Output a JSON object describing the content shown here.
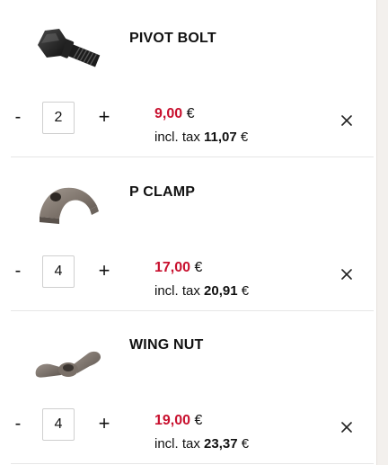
{
  "cart": {
    "items": [
      {
        "name": "PIVOT BOLT",
        "quantity": "2",
        "price": "9,00",
        "currency": "€",
        "tax_label": "incl. tax",
        "price_incl_tax": "11,07",
        "image": "pivot-bolt-image"
      },
      {
        "name": "P CLAMP",
        "quantity": "4",
        "price": "17,00",
        "currency": "€",
        "tax_label": "incl. tax",
        "price_incl_tax": "20,91",
        "image": "p-clamp-image"
      },
      {
        "name": "WING NUT",
        "quantity": "4",
        "price": "19,00",
        "currency": "€",
        "tax_label": "incl. tax",
        "price_incl_tax": "23,37",
        "image": "wing-nut-image"
      }
    ],
    "minus_label": "-",
    "plus_label": "+",
    "remove_icon": "close-icon"
  },
  "colors": {
    "price_red": "#c8102e",
    "background": "#f3f0ed",
    "panel": "#ffffff",
    "divider": "#e6e6e6"
  }
}
